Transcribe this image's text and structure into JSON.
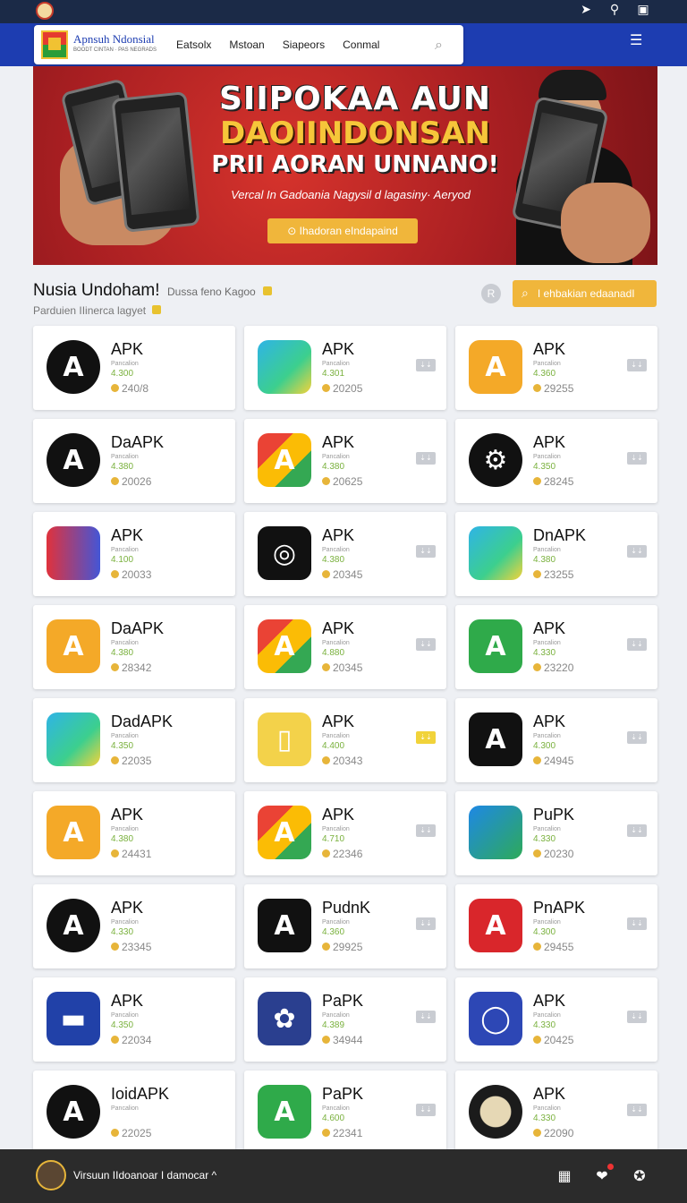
{
  "statusbar": {
    "icons": [
      "location-icon",
      "key-icon",
      "info-icon"
    ]
  },
  "nav": {
    "brand_title": "Apnsuh Ndonsial",
    "brand_sub": "BOODT CINTAN · PAS NEGRADS",
    "links": [
      "Eatsolx",
      "Mstoan",
      "Siapeors",
      "Conmal"
    ]
  },
  "hero": {
    "line1": "SIIPOKAA AUN",
    "line2": "DAOIINDONSAN",
    "line3": "PRII AORAN UNNANO!",
    "subtitle": "Vercal In Gadoania Nagysil d lagasiny· Aeryod",
    "button": "⊙ Ihadoran eIndapaind"
  },
  "section": {
    "title": "Nusia Undoham!",
    "aside": "Dussa feno Kagoo",
    "subtitle": "Parduien IIinerca lagyet",
    "badge": "R",
    "search_label": "I ehbakian edaanadI"
  },
  "cards": [
    {
      "title": "APK",
      "version": "4.300",
      "downloads": "240/8",
      "tag": null
    },
    {
      "title": "APK",
      "version": "4.301",
      "downloads": "20205",
      "tag": "grey"
    },
    {
      "title": "APK",
      "version": "4.360",
      "downloads": "29255",
      "tag": "grey"
    },
    {
      "title": "DaAPK",
      "version": "4.380",
      "downloads": "20026",
      "tag": null
    },
    {
      "title": "APK",
      "version": "4.380",
      "downloads": "20625",
      "tag": "grey"
    },
    {
      "title": "APK",
      "version": "4.350",
      "downloads": "28245",
      "tag": "grey"
    },
    {
      "title": "APK",
      "version": "4.100",
      "downloads": "20033",
      "tag": null
    },
    {
      "title": "APK",
      "version": "4.380",
      "downloads": "20345",
      "tag": "grey"
    },
    {
      "title": "DnAPK",
      "version": "4.380",
      "downloads": "23255",
      "tag": "grey"
    },
    {
      "title": "DaAPK",
      "version": "4.380",
      "downloads": "28342",
      "tag": null
    },
    {
      "title": "APK",
      "version": "4.880",
      "downloads": "20345",
      "tag": "grey"
    },
    {
      "title": "APK",
      "version": "4.330",
      "downloads": "23220",
      "tag": "grey"
    },
    {
      "title": "DadAPK",
      "version": "4.350",
      "downloads": "22035",
      "tag": null
    },
    {
      "title": "APK",
      "version": "4.400",
      "downloads": "20343",
      "tag": "yellow"
    },
    {
      "title": "APK",
      "version": "4.300",
      "downloads": "24945",
      "tag": "grey"
    },
    {
      "title": "APK",
      "version": "4.380",
      "downloads": "24431",
      "tag": null
    },
    {
      "title": "APK",
      "version": "4.710",
      "downloads": "22346",
      "tag": "grey"
    },
    {
      "title": "PuPK",
      "version": "4.330",
      "downloads": "20230",
      "tag": "grey"
    },
    {
      "title": "APK",
      "version": "4.330",
      "downloads": "23345",
      "tag": null
    },
    {
      "title": "PudnK",
      "version": "4.360",
      "downloads": "29925",
      "tag": "grey"
    },
    {
      "title": "PnAPK",
      "version": "4.300",
      "downloads": "29455",
      "tag": "grey"
    },
    {
      "title": "APK",
      "version": "4.350",
      "downloads": "22034",
      "tag": null
    },
    {
      "title": "PaPK",
      "version": "4.389",
      "downloads": "34944",
      "tag": "grey"
    },
    {
      "title": "APK",
      "version": "4.330",
      "downloads": "20425",
      "tag": "grey"
    },
    {
      "title": "IoidAPK",
      "version": "",
      "downloads": "22025",
      "tag": null
    },
    {
      "title": "PaPK",
      "version": "4.600",
      "downloads": "22341",
      "tag": "grey"
    },
    {
      "title": "APK",
      "version": "4.330",
      "downloads": "22090",
      "tag": "grey"
    }
  ],
  "card_subtitle": "Pancalion",
  "icons": [
    "black-circle-app-icon",
    "map-app-icon",
    "orange-triangle-app-icon",
    "black-circle-app-icon",
    "multicolor-triangle-app-icon",
    "badge-app-icon",
    "red-blue-triangle-app-icon",
    "camera-app-icon",
    "map-app-icon",
    "orange-triangle-app-icon",
    "multicolor-triangle-app-icon",
    "green-triangle-app-icon",
    "map-app-icon",
    "phone-sketch-app-icon",
    "black-square-app-icon",
    "orange-triangle-app-icon",
    "multicolor-triangle-app-icon",
    "green-blue-triangle-app-icon",
    "black-circle-app-icon",
    "black-square-app-icon",
    "red-square-app-icon",
    "blue-card-app-icon",
    "orange-maple-app-icon",
    "shield-app-icon",
    "black-circle-app-icon",
    "green-triangle-app-icon",
    "emblem-app-icon"
  ],
  "bottombar": {
    "text": "Virsuun IIdoanoar I damocar",
    "icons": [
      "grid-icon",
      "chat-icon",
      "profile-icon"
    ]
  },
  "colors": {
    "navy": "#1b2a47",
    "blue": "#1d3db1",
    "hero_red": "#c1282a",
    "accent": "#f0b63b",
    "version_green": "#7ab13e"
  }
}
